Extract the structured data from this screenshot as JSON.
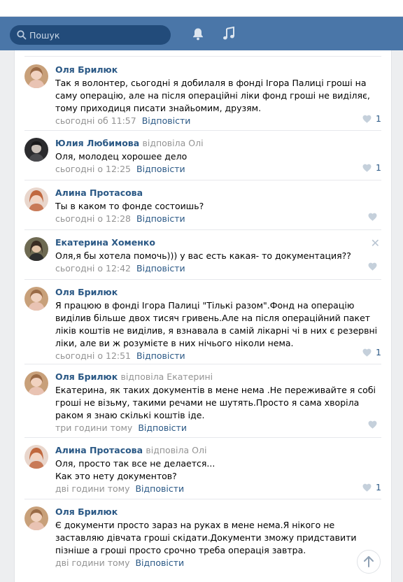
{
  "search": {
    "placeholder": "Пошук"
  },
  "header_icons": [
    "bell-icon",
    "music-note-icon"
  ],
  "reply_label": "Відповісти",
  "comments": [
    {
      "author": "Оля Брилюк",
      "reply_to": "",
      "text": "Так я волонтер, сьогодні я добилаля в фонді Ігора Палиці гроші на саму операцію, але на після операційні ліки фонд гроші не виділяє, тому приходиця писати знайьомим, друзям.",
      "time": "сьогодні об 11:57",
      "likes": "1"
    },
    {
      "author": "Юлия Любимова",
      "reply_to": "відповіла Олі",
      "text": "Оля, молодец хорошее дело",
      "time": "сьогодні о 12:25",
      "likes": "1"
    },
    {
      "author": "Алина Протасова",
      "reply_to": "",
      "text": "Ты в каком то фонде состоишь?",
      "time": "сьогодні о 12:28",
      "likes": ""
    },
    {
      "author": "Екатерина Хоменко",
      "reply_to": "",
      "text": "Оля,я бы хотела помочь))) у вас есть какая- то документация??",
      "time": "сьогодні о 12:42",
      "likes": ""
    },
    {
      "author": "Оля Брилюк",
      "reply_to": "",
      "text": "Я працюю в фонді Ігора Палиці \"Тількі разом\".Фонд на операцію виділив більше двох тисяч гривень.Але на після операційний пакет ліків коштів не виділив, я взнавала в самій лікарні чі в них є резервні ліки, але ви ж розумієте в них нічього ніколи нема.",
      "time": "сьогодні о 12:51",
      "likes": "1"
    },
    {
      "author": "Оля Брилюк",
      "reply_to": "відповіла Екатерині",
      "text": "Екатерина, як таких документів в мене нема .Не переживайте я собі гроші не візьму, такими речами не шутять.Просто я сама хворіла раком я знаю скількі коштів іде.",
      "time": "три години тому",
      "likes": ""
    },
    {
      "author": "Алина Протасова",
      "reply_to": "відповіла Олі",
      "text": "Оля, просто так все не делается...\nКак это нету документов?",
      "time": "дві години тому",
      "likes": "1"
    },
    {
      "author": "Оля Брилюк",
      "reply_to": "",
      "text": "Є документи просто зараз на руках в мене нема.Я нікого не заставляю дівчата гроші скідати.Документи зможу придставити пізніше а гроші просто срочно треба операція завтра.",
      "time": "дві години тому",
      "likes": ""
    }
  ]
}
